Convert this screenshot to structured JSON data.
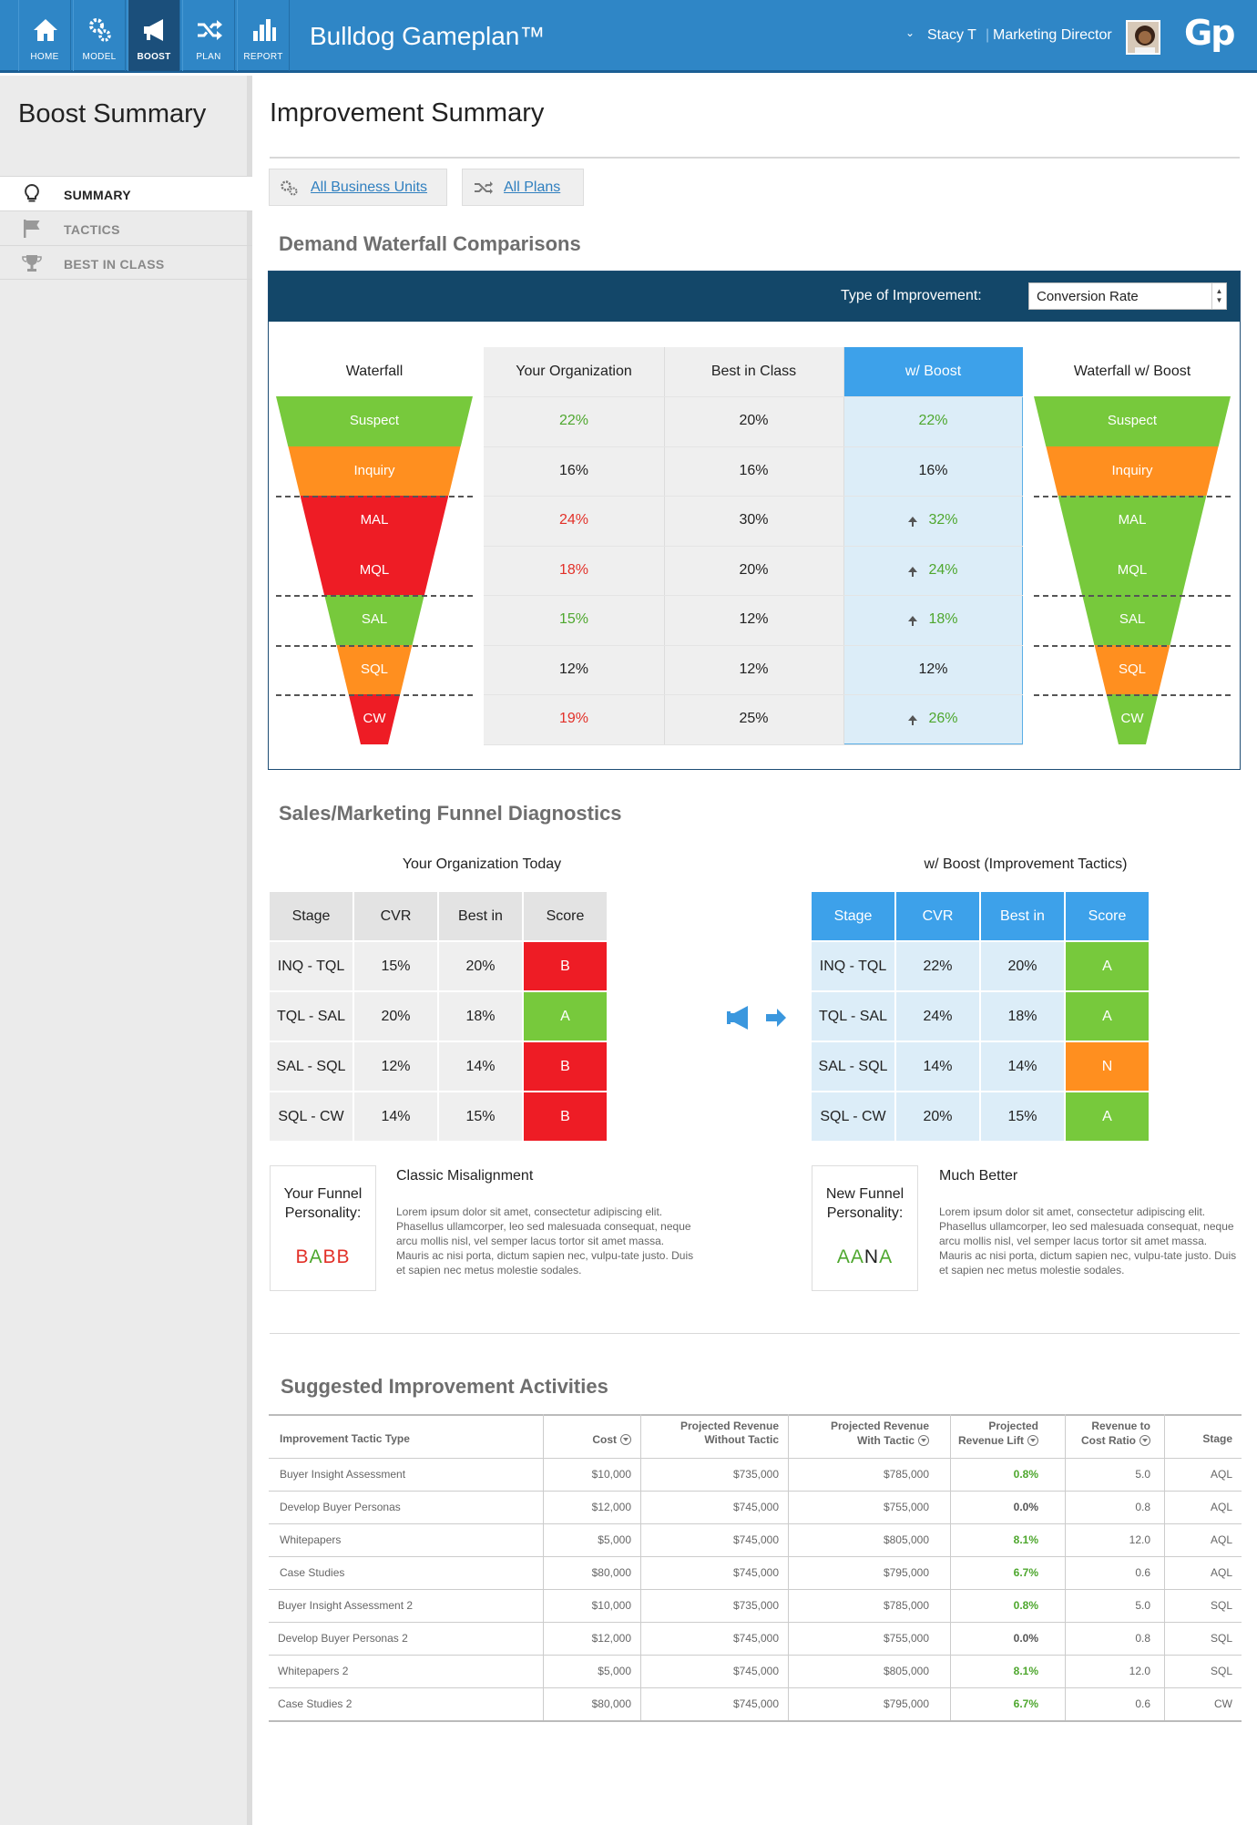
{
  "app": {
    "title": "Bulldog Gameplan™",
    "logo": "Gp"
  },
  "nav": [
    {
      "label": "HOME",
      "icon": "home-icon"
    },
    {
      "label": "MODEL",
      "icon": "gears-icon"
    },
    {
      "label": "BOOST",
      "icon": "megaphone-icon",
      "active": true
    },
    {
      "label": "PLAN",
      "icon": "shuffle-icon"
    },
    {
      "label": "REPORT",
      "icon": "bar-chart-icon"
    }
  ],
  "user": {
    "name": "Stacy T",
    "role": "Marketing Director"
  },
  "sidebar": {
    "title": "Boost Summary",
    "items": [
      {
        "label": "SUMMARY",
        "icon": "lightbulb-icon",
        "active": true
      },
      {
        "label": "TACTICS",
        "icon": "flag-icon"
      },
      {
        "label": "BEST IN CLASS",
        "icon": "trophy-icon"
      }
    ]
  },
  "main": {
    "title": "Improvement Summary",
    "filters": {
      "business_units": "All Business Units",
      "plans": "All Plans"
    }
  },
  "waterfall": {
    "section_title": "Demand Waterfall Comparisons",
    "improvement_label": "Type of Improvement:",
    "improvement_value": "Conversion Rate",
    "headers": {
      "waterfall": "Waterfall",
      "org": "Your Organization",
      "bic": "Best in Class",
      "boost": "w/ Boost",
      "waterfall_boost": "Waterfall w/ Boost"
    },
    "stages": [
      "Suspect",
      "Inquiry",
      "MAL",
      "MQL",
      "SAL",
      "SQL",
      "CW"
    ],
    "left_colors": [
      "#77c93c",
      "#ff8f1f",
      "#ee1c25",
      "#ee1c25",
      "#77c93c",
      "#ff8f1f",
      "#ee1c25"
    ],
    "right_colors": [
      "#77c93c",
      "#ff8f1f",
      "#77c93c",
      "#77c93c",
      "#77c93c",
      "#ff8f1f",
      "#77c93c"
    ],
    "org": [
      {
        "v": "22%",
        "c": "green"
      },
      {
        "v": "16%",
        "c": ""
      },
      {
        "v": "24%",
        "c": "red"
      },
      {
        "v": "18%",
        "c": "red"
      },
      {
        "v": "15%",
        "c": "green"
      },
      {
        "v": "12%",
        "c": ""
      },
      {
        "v": "19%",
        "c": "red"
      }
    ],
    "bic": [
      "20%",
      "16%",
      "30%",
      "20%",
      "12%",
      "12%",
      "25%"
    ],
    "boost": [
      {
        "v": "22%",
        "c": "green",
        "up": false
      },
      {
        "v": "16%",
        "c": "",
        "up": false
      },
      {
        "v": "32%",
        "c": "green",
        "up": true
      },
      {
        "v": "24%",
        "c": "green",
        "up": true
      },
      {
        "v": "18%",
        "c": "green",
        "up": true
      },
      {
        "v": "12%",
        "c": "",
        "up": false
      },
      {
        "v": "26%",
        "c": "green",
        "up": true
      }
    ]
  },
  "diagnostics": {
    "section_title": "Sales/Marketing Funnel Diagnostics",
    "today": {
      "title": "Your Organization Today",
      "headers": [
        "Stage",
        "CVR",
        "Best in Class",
        "Score"
      ],
      "rows": [
        [
          "INQ - TQL",
          "15%",
          "20%",
          "B"
        ],
        [
          "TQL - SAL",
          "20%",
          "18%",
          "A"
        ],
        [
          "SAL - SQL",
          "12%",
          "14%",
          "B"
        ],
        [
          "SQL - CW",
          "14%",
          "15%",
          "B"
        ]
      ],
      "score_colors": [
        "#ee1c25",
        "#77c93c",
        "#ee1c25",
        "#ee1c25"
      ],
      "personality_label": "Your Funnel Personality:",
      "personality_code": "BABB",
      "personality_colors": [
        "#e23028",
        "#4ea72e",
        "#e23028",
        "#e23028"
      ],
      "desc_title": "Classic Misalignment",
      "desc": "Lorem ipsum dolor sit amet, consectetur adipiscing elit. Phasellus ullamcorper, leo sed malesuada consequat, neque arcu mollis nisl, vel semper lacus tortor sit amet massa. Mauris ac nisi porta, dictum sapien nec, vulpu-tate justo. Duis et sapien nec metus molestie sodales."
    },
    "boost": {
      "title": "w/ Boost (Improvement Tactics)",
      "headers": [
        "Stage",
        "CVR",
        "Best in Class",
        "Score"
      ],
      "rows": [
        [
          "INQ - TQL",
          "22%",
          "20%",
          "A"
        ],
        [
          "TQL - SAL",
          "24%",
          "18%",
          "A"
        ],
        [
          "SAL - SQL",
          "14%",
          "14%",
          "N"
        ],
        [
          "SQL - CW",
          "20%",
          "15%",
          "A"
        ]
      ],
      "score_colors": [
        "#77c93c",
        "#77c93c",
        "#ff8f1f",
        "#77c93c"
      ],
      "personality_label": "New Funnel Personality:",
      "personality_code": "AANA",
      "personality_colors": [
        "#4ea72e",
        "#4ea72e",
        "#222222",
        "#4ea72e"
      ],
      "desc_title": "Much Better",
      "desc": "Lorem ipsum dolor sit amet, consectetur adipiscing elit. Phasellus ullamcorper, leo sed malesuada consequat, neque arcu mollis nisl, vel semper lacus tortor sit amet massa. Mauris ac nisi porta, dictum sapien nec, vulpu-tate justo. Duis et sapien nec metus molestie sodales."
    }
  },
  "activities": {
    "section_title": "Suggested Improvement Activities",
    "headers": [
      "Improvement Tactic Type",
      "Cost",
      "Projected Revenue\nWithout Tactic",
      "Projected Revenue\nWith Tactic",
      "Projected\nRevenue Lift",
      "Revenue to\nCost Ratio",
      "Stage"
    ],
    "rows": [
      [
        "Buyer Insight Assessment",
        "$10,000",
        "$735,000",
        "$785,000",
        "0.8%",
        "5.0",
        "AQL"
      ],
      [
        "Develop Buyer Personas",
        "$12,000",
        "$745,000",
        "$755,000",
        "0.0%",
        "0.8",
        "AQL"
      ],
      [
        "Whitepapers",
        "$5,000",
        "$745,000",
        "$805,000",
        "8.1%",
        "12.0",
        "AQL"
      ],
      [
        "Case Studies",
        "$80,000",
        "$745,000",
        "$795,000",
        "6.7%",
        "0.6",
        "AQL"
      ],
      [
        "Buyer Insight Assessment 2",
        "$10,000",
        "$735,000",
        "$785,000",
        "0.8%",
        "5.0",
        "SQL"
      ],
      [
        "Develop Buyer Personas 2",
        "$12,000",
        "$745,000",
        "$755,000",
        "0.0%",
        "0.8",
        "SQL"
      ],
      [
        "Whitepapers 2",
        "$5,000",
        "$745,000",
        "$805,000",
        "8.1%",
        "12.0",
        "SQL"
      ],
      [
        "Case Studies 2",
        "$80,000",
        "$745,000",
        "$795,000",
        "6.7%",
        "0.6",
        "CW"
      ]
    ]
  }
}
